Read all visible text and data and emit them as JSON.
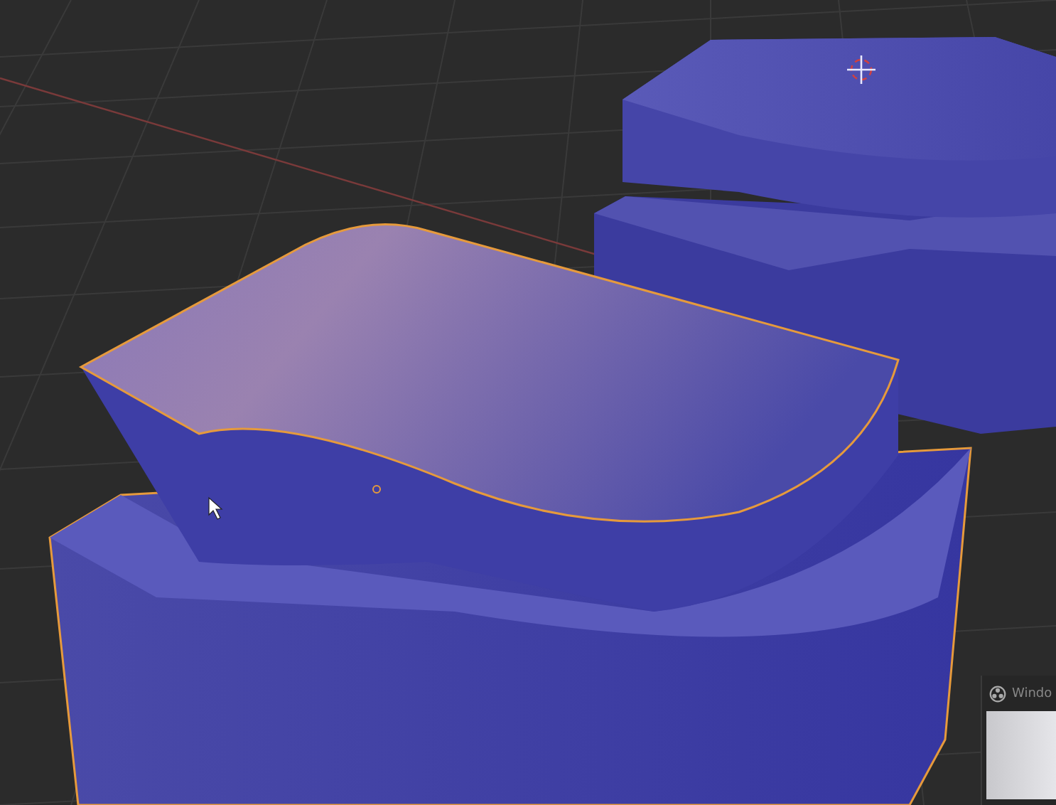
{
  "popup": {
    "title": "Windo"
  }
}
